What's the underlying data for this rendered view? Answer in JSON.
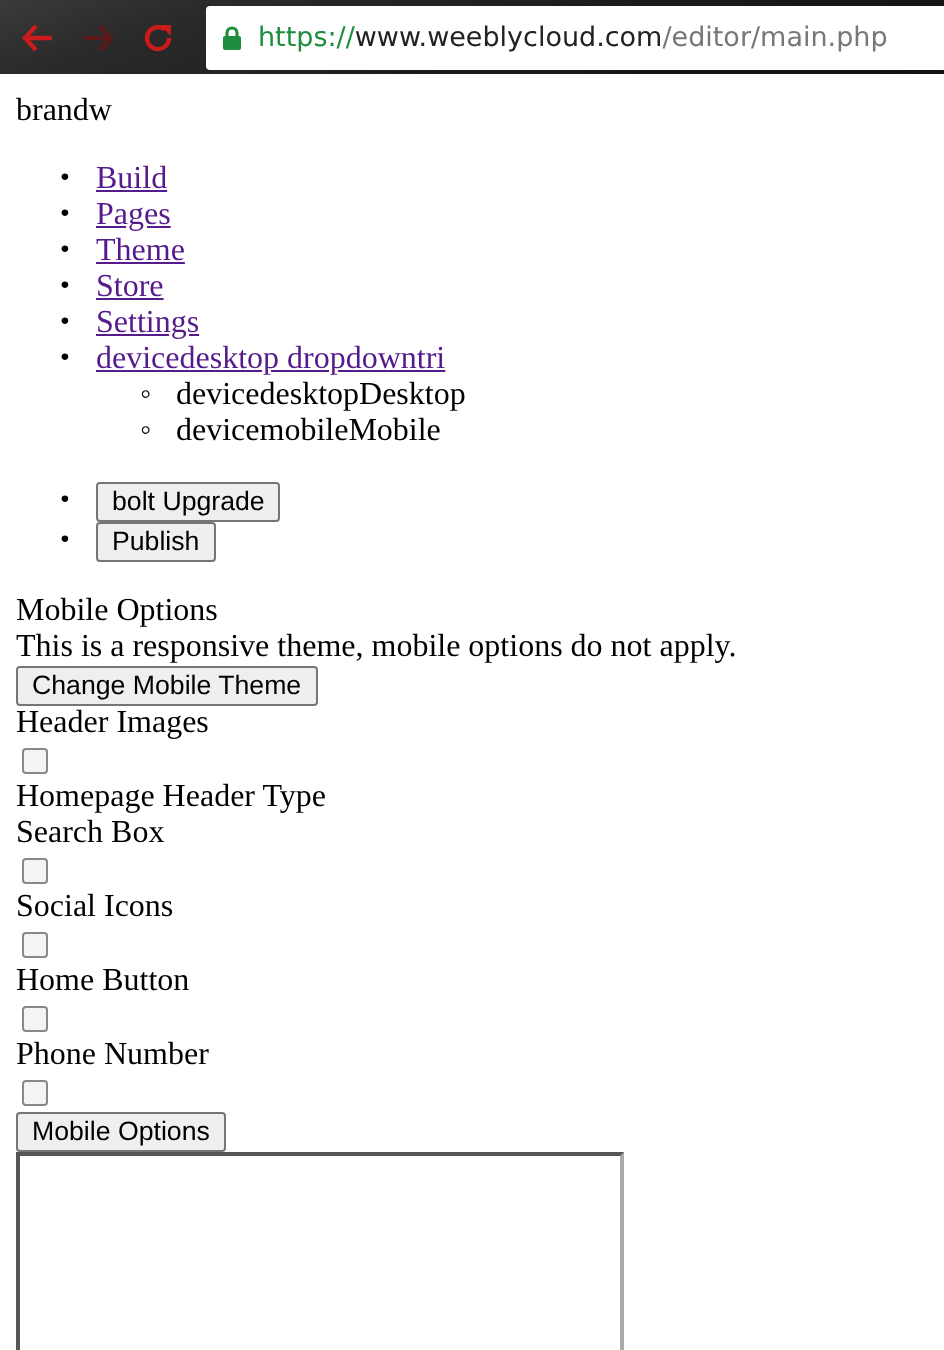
{
  "browser": {
    "nav_buttons": [
      {
        "kind": "back",
        "disabled": false
      },
      {
        "kind": "forward",
        "disabled": true
      },
      {
        "kind": "reload",
        "disabled": false
      }
    ],
    "url": {
      "scheme": "https://",
      "host": "www.weeblycloud.com",
      "path": "/editor/main.php"
    }
  },
  "brand": "brandw",
  "nav": [
    {
      "marker": "•",
      "label": "Build"
    },
    {
      "marker": "•",
      "label": "Pages"
    },
    {
      "marker": "•",
      "label": "Theme"
    },
    {
      "marker": "•",
      "label": "Store"
    },
    {
      "marker": "•",
      "label": "Settings"
    },
    {
      "marker": "•",
      "label": "devicedesktop dropdowntri",
      "children": [
        {
          "marker": "◦",
          "label": "devicedesktopDesktop"
        },
        {
          "marker": "◦",
          "label": "devicemobileMobile"
        }
      ]
    }
  ],
  "actions": [
    {
      "marker": "•",
      "label": "bolt Upgrade"
    },
    {
      "marker": "•",
      "label": "Publish"
    }
  ],
  "options": [
    {
      "kind": "text",
      "text": "Mobile Options"
    },
    {
      "kind": "text",
      "text": "This is a responsive theme, mobile options do not apply."
    },
    {
      "kind": "button",
      "text": "Change Mobile Theme"
    },
    {
      "kind": "text",
      "text": "Header Images"
    },
    {
      "kind": "checkbox",
      "checked": false
    },
    {
      "kind": "text",
      "text": "Homepage Header Type"
    },
    {
      "kind": "text",
      "text": "Search Box"
    },
    {
      "kind": "checkbox",
      "checked": false
    },
    {
      "kind": "text",
      "text": "Social Icons"
    },
    {
      "kind": "checkbox",
      "checked": false
    },
    {
      "kind": "text",
      "text": "Home Button"
    },
    {
      "kind": "checkbox",
      "checked": false
    },
    {
      "kind": "text",
      "text": "Phone Number"
    },
    {
      "kind": "checkbox",
      "checked": false
    },
    {
      "kind": "button",
      "text": "Mobile Options"
    },
    {
      "kind": "frame"
    }
  ]
}
